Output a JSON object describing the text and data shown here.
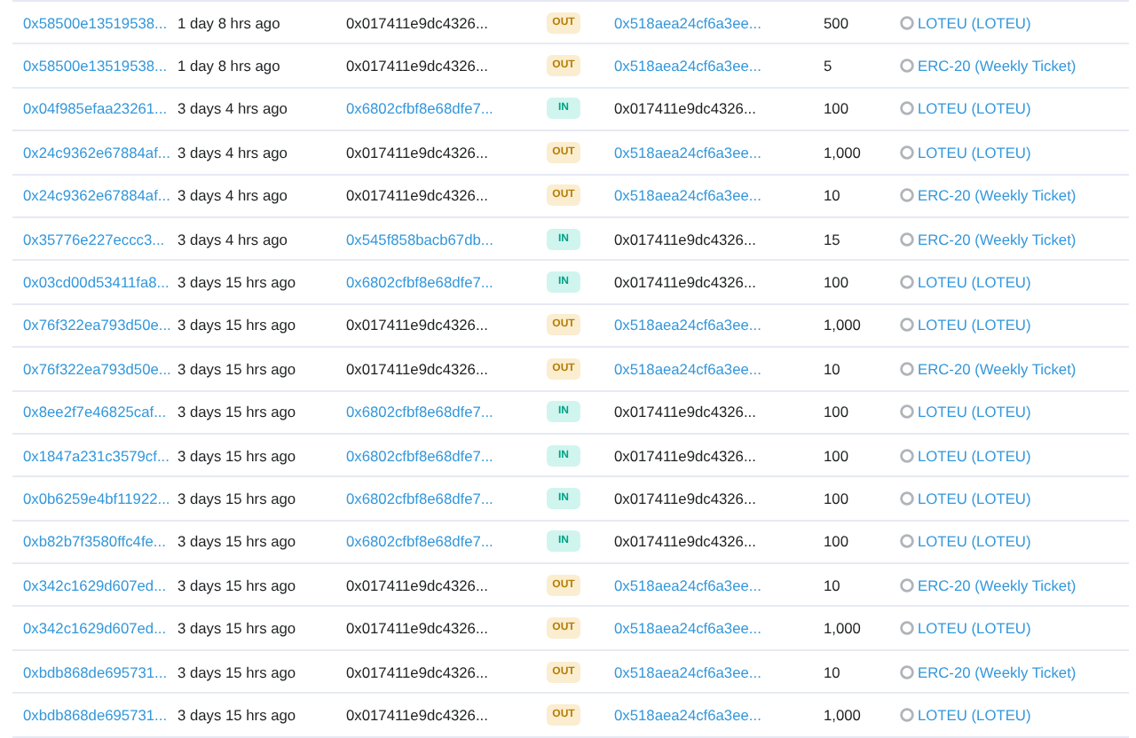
{
  "transfers": [
    {
      "hash": "0x58500e13519538...",
      "age": "1 day 8 hrs ago",
      "from": "0x017411e9dc4326...",
      "direction": "OUT",
      "kind": "out",
      "to": "0x518aea24cf6a3ee...",
      "value": "500",
      "token": "LOTEU (LOTEU)"
    },
    {
      "hash": "0x58500e13519538...",
      "age": "1 day 8 hrs ago",
      "from": "0x017411e9dc4326...",
      "direction": "OUT",
      "kind": "out",
      "to": "0x518aea24cf6a3ee...",
      "value": "5",
      "token": "ERC-20 (Weekly Ticket)"
    },
    {
      "hash": "0x04f985efaa23261...",
      "age": "3 days 4 hrs ago",
      "from": "0x6802cfbf8e68dfe7...",
      "direction": "IN",
      "kind": "in",
      "to": "0x017411e9dc4326...",
      "value": "100",
      "token": "LOTEU (LOTEU)"
    },
    {
      "hash": "0x24c9362e67884af...",
      "age": "3 days 4 hrs ago",
      "from": "0x017411e9dc4326...",
      "direction": "OUT",
      "kind": "out",
      "to": "0x518aea24cf6a3ee...",
      "value": "1,000",
      "token": "LOTEU (LOTEU)"
    },
    {
      "hash": "0x24c9362e67884af...",
      "age": "3 days 4 hrs ago",
      "from": "0x017411e9dc4326...",
      "direction": "OUT",
      "kind": "out",
      "to": "0x518aea24cf6a3ee...",
      "value": "10",
      "token": "ERC-20 (Weekly Ticket)"
    },
    {
      "hash": "0x35776e227eccc3...",
      "age": "3 days 4 hrs ago",
      "from": "0x545f858bacb67db...",
      "direction": "IN",
      "kind": "in",
      "to": "0x017411e9dc4326...",
      "value": "15",
      "token": "ERC-20 (Weekly Ticket)"
    },
    {
      "hash": "0x03cd00d53411fa8...",
      "age": "3 days 15 hrs ago",
      "from": "0x6802cfbf8e68dfe7...",
      "direction": "IN",
      "kind": "in",
      "to": "0x017411e9dc4326...",
      "value": "100",
      "token": "LOTEU (LOTEU)"
    },
    {
      "hash": "0x76f322ea793d50e...",
      "age": "3 days 15 hrs ago",
      "from": "0x017411e9dc4326...",
      "direction": "OUT",
      "kind": "out",
      "to": "0x518aea24cf6a3ee...",
      "value": "1,000",
      "token": "LOTEU (LOTEU)"
    },
    {
      "hash": "0x76f322ea793d50e...",
      "age": "3 days 15 hrs ago",
      "from": "0x017411e9dc4326...",
      "direction": "OUT",
      "kind": "out",
      "to": "0x518aea24cf6a3ee...",
      "value": "10",
      "token": "ERC-20 (Weekly Ticket)"
    },
    {
      "hash": "0x8ee2f7e46825caf...",
      "age": "3 days 15 hrs ago",
      "from": "0x6802cfbf8e68dfe7...",
      "direction": "IN",
      "kind": "in",
      "to": "0x017411e9dc4326...",
      "value": "100",
      "token": "LOTEU (LOTEU)"
    },
    {
      "hash": "0x1847a231c3579cf...",
      "age": "3 days 15 hrs ago",
      "from": "0x6802cfbf8e68dfe7...",
      "direction": "IN",
      "kind": "in",
      "to": "0x017411e9dc4326...",
      "value": "100",
      "token": "LOTEU (LOTEU)"
    },
    {
      "hash": "0x0b6259e4bf11922...",
      "age": "3 days 15 hrs ago",
      "from": "0x6802cfbf8e68dfe7...",
      "direction": "IN",
      "kind": "in",
      "to": "0x017411e9dc4326...",
      "value": "100",
      "token": "LOTEU (LOTEU)"
    },
    {
      "hash": "0xb82b7f3580ffc4fe...",
      "age": "3 days 15 hrs ago",
      "from": "0x6802cfbf8e68dfe7...",
      "direction": "IN",
      "kind": "in",
      "to": "0x017411e9dc4326...",
      "value": "100",
      "token": "LOTEU (LOTEU)"
    },
    {
      "hash": "0x342c1629d607ed...",
      "age": "3 days 15 hrs ago",
      "from": "0x017411e9dc4326...",
      "direction": "OUT",
      "kind": "out",
      "to": "0x518aea24cf6a3ee...",
      "value": "10",
      "token": "ERC-20 (Weekly Ticket)"
    },
    {
      "hash": "0x342c1629d607ed...",
      "age": "3 days 15 hrs ago",
      "from": "0x017411e9dc4326...",
      "direction": "OUT",
      "kind": "out",
      "to": "0x518aea24cf6a3ee...",
      "value": "1,000",
      "token": "LOTEU (LOTEU)"
    },
    {
      "hash": "0xbdb868de695731...",
      "age": "3 days 15 hrs ago",
      "from": "0x017411e9dc4326...",
      "direction": "OUT",
      "kind": "out",
      "to": "0x518aea24cf6a3ee...",
      "value": "10",
      "token": "ERC-20 (Weekly Ticket)"
    },
    {
      "hash": "0xbdb868de695731...",
      "age": "3 days 15 hrs ago",
      "from": "0x017411e9dc4326...",
      "direction": "OUT",
      "kind": "out",
      "to": "0x518aea24cf6a3ee...",
      "value": "1,000",
      "token": "LOTEU (LOTEU)"
    }
  ]
}
